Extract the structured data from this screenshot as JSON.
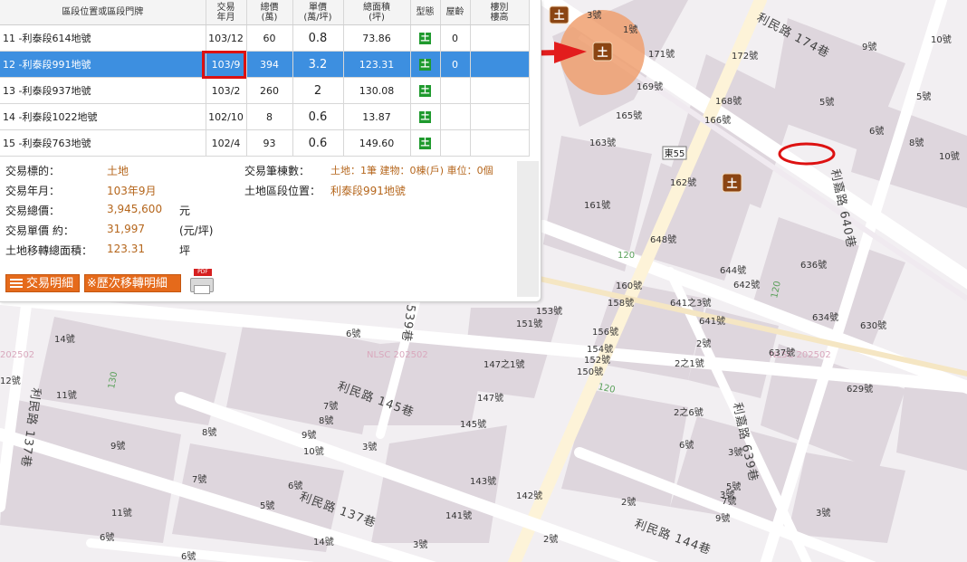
{
  "table": {
    "headers": [
      "區段位置或區段門牌",
      "交易\n年月",
      "總價\n(萬)",
      "單價\n(萬/坪)",
      "總面積\n(坪)",
      "型態",
      "屋齡",
      "樓別\n樓高"
    ],
    "rows": [
      {
        "location": "11 -利泰段614地號",
        "date": "103/12",
        "total": "60",
        "unit": "0.8",
        "area": "73.86",
        "type": "土",
        "age": "0",
        "floor": ""
      },
      {
        "location": "12 -利泰段991地號",
        "date": "103/9",
        "total": "394",
        "unit": "3.2",
        "area": "123.31",
        "type": "土",
        "age": "0",
        "floor": ""
      },
      {
        "location": "13 -利泰段937地號",
        "date": "103/2",
        "total": "260",
        "unit": "2",
        "area": "130.08",
        "type": "土",
        "age": "",
        "floor": ""
      },
      {
        "location": "14 -利泰段1022地號",
        "date": "102/10",
        "total": "8",
        "unit": "0.6",
        "area": "13.87",
        "type": "土",
        "age": "",
        "floor": ""
      },
      {
        "location": "15 -利泰段763地號",
        "date": "102/4",
        "total": "93",
        "unit": "0.6",
        "area": "149.60",
        "type": "土",
        "age": "",
        "floor": ""
      }
    ]
  },
  "detail": {
    "target_label": "交易標的：",
    "target_value": "土地",
    "date_label": "交易年月：",
    "date_value": "103年9月",
    "total_label": "交易總價：",
    "total_value": "3,945,600",
    "total_unit": "元",
    "unit_label": "交易單價 約：",
    "unit_value": "31,997",
    "unit_unit": "(元/坪)",
    "area_label": "土地移轉總面積：",
    "area_value": "123.31",
    "area_unit": "坪",
    "count_label": "交易筆棟數：",
    "count_value": "土地：1筆 建物：0棟(戶) 車位：0個",
    "section_label": "土地區段位置：",
    "section_value": "利泰段991地號"
  },
  "buttons": {
    "detail": "交易明細",
    "history": "※歷次移轉明細",
    "pdf": "PDF"
  },
  "map": {
    "marker_glyph": "土",
    "road_174": "利民路 174巷",
    "road_145": "利民路 145巷",
    "road_137": "利民路 137巷",
    "road_144": "利民路 144巷",
    "road_640": "利嘉路 640巷",
    "road_639": "利嘉路 639巷",
    "road_539": "539巷",
    "road_137l": "利民路 137巷",
    "road_east55": "東55",
    "hw_120a": "120",
    "hw_120b": "120",
    "hw_120c": "120",
    "hw_130": "130",
    "wm_1": "NLSC 202502",
    "wm_2": "NLSC 202502",
    "wm_3": "202502",
    "labels": [
      "3號",
      "1號",
      "171號",
      "172號",
      "169號",
      "9號",
      "10號",
      "168號",
      "5號",
      "5號",
      "165號",
      "166號",
      "6號",
      "8號",
      "163號",
      "10號",
      "162號",
      "161號",
      "648號",
      "644號",
      "642號",
      "636號",
      "634號",
      "630號",
      "160號",
      "158號",
      "641之3號",
      "641號",
      "153號",
      "151號",
      "156號",
      "2號",
      "154號",
      "152號",
      "150號",
      "147之1號",
      "147號",
      "145號",
      "2之1號",
      "637號",
      "629號",
      "2之6號",
      "6號",
      "3號",
      "14號",
      "11號",
      "6號",
      "7號",
      "8號",
      "9號",
      "10號",
      "8號",
      "9號",
      "3號",
      "7號",
      "5號",
      "6號",
      "143號",
      "141號",
      "142號",
      "2號",
      "3號",
      "2號",
      "5號",
      "7號",
      "9號",
      "11號",
      "6號",
      "12號",
      "14號",
      "3號",
      "3號",
      "6號",
      "8號"
    ]
  },
  "colors": {
    "select": "#3d8fe0",
    "accent": "#e56a1b",
    "value": "#b5661c",
    "land": "#1f9a2e",
    "arrow": "#e21d1d"
  }
}
